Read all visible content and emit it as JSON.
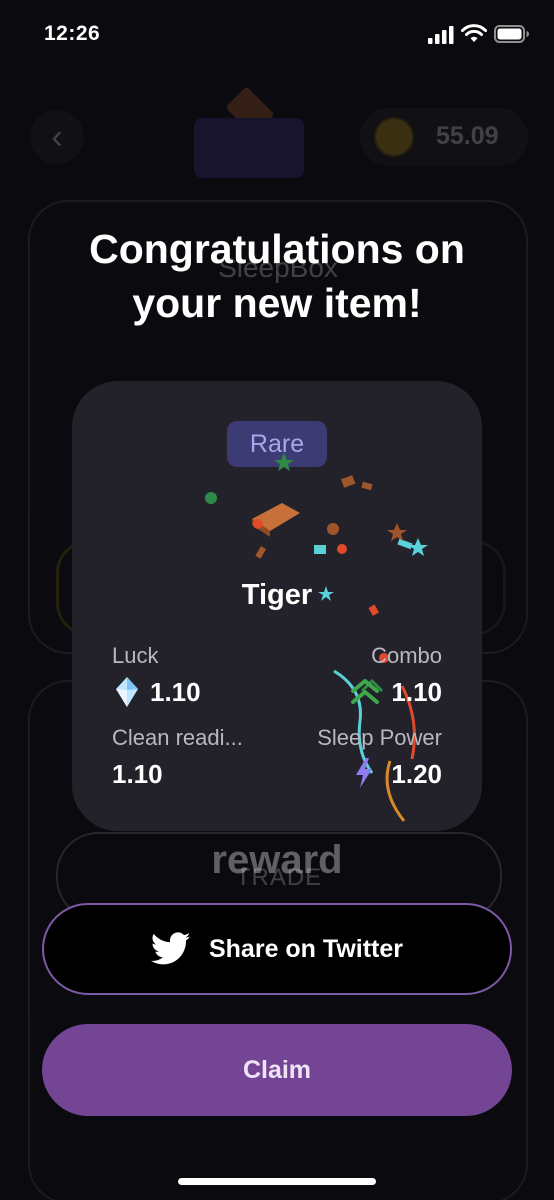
{
  "status_bar": {
    "time": "12:26",
    "icons": [
      "cellular-signal-icon",
      "wifi-icon",
      "battery-icon"
    ]
  },
  "background_page": {
    "balance_value": "55.09",
    "box_title": "SleepBox",
    "trade_label": "TRADE",
    "overlay_word": "reward"
  },
  "modal": {
    "title": "Congratulations on your new item!",
    "item": {
      "rarity": "Rare",
      "name": "Tiger",
      "attributes": {
        "luck": {
          "label": "Luck",
          "value": "1.10",
          "icon": "crystal-icon"
        },
        "combo": {
          "label": "Combo",
          "value": "1.10",
          "icon": "chevron-up-icon"
        },
        "clean_reading": {
          "label": "Clean readi...",
          "value": "1.10"
        },
        "sleep_power": {
          "label": "Sleep Power",
          "value": "1.20",
          "icon": "lightning-icon"
        }
      }
    },
    "share_button": {
      "label": "Share on Twitter",
      "icon": "twitter-bird-icon"
    },
    "claim_button": {
      "label": "Claim"
    }
  },
  "colors": {
    "rarity_badge_bg": "#3d3b73",
    "rarity_text": "#a7a6ec",
    "claim_bg": "#744595",
    "share_border": "#7d5aa6",
    "card_bg": "#23222b"
  }
}
